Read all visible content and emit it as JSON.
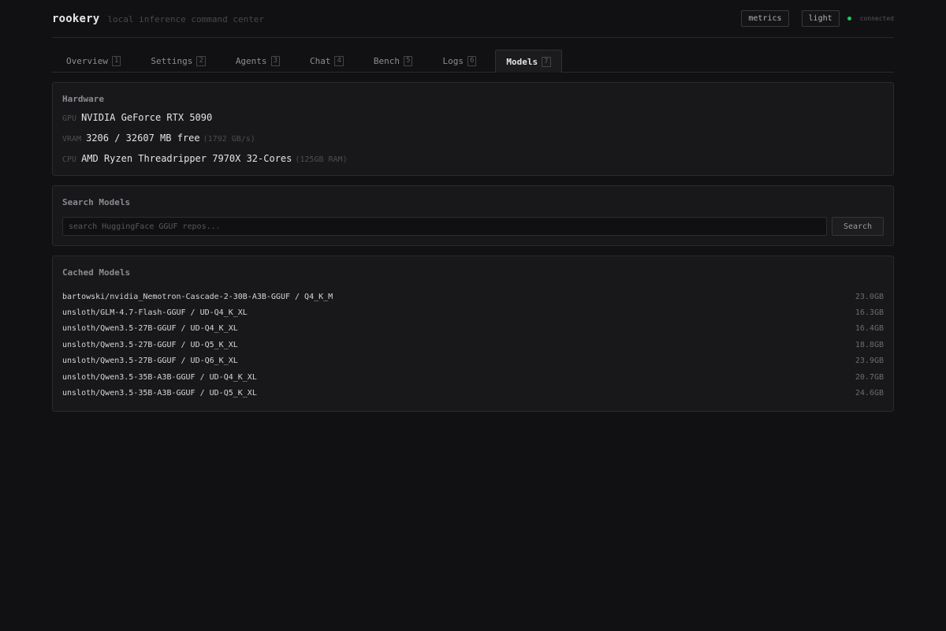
{
  "header": {
    "logo": "rookery",
    "tagline": "local inference command center",
    "metrics_label": "metrics",
    "theme_label": "light",
    "status_text": "connected",
    "status_color": "#22c55e"
  },
  "tabs": [
    {
      "label": "Overview",
      "key": "1",
      "active": false
    },
    {
      "label": "Settings",
      "key": "2",
      "active": false
    },
    {
      "label": "Agents",
      "key": "3",
      "active": false
    },
    {
      "label": "Chat",
      "key": "4",
      "active": false
    },
    {
      "label": "Bench",
      "key": "5",
      "active": false
    },
    {
      "label": "Logs",
      "key": "6",
      "active": false
    },
    {
      "label": "Models",
      "key": "7",
      "active": true
    }
  ],
  "hardware": {
    "title": "Hardware",
    "gpu_key": "GPU",
    "gpu_value": "NVIDIA GeForce RTX 5090",
    "vram_key": "VRAM",
    "vram_value": "3206 / 32607 MB free",
    "vram_note": "(1792 GB/s)",
    "cpu_key": "CPU",
    "cpu_value": "AMD Ryzen Threadripper 7970X 32-Cores",
    "cpu_note": "(125GB RAM)"
  },
  "search": {
    "title": "Search Models",
    "placeholder": "search HuggingFace GGUF repos...",
    "value": "",
    "button_label": "Search"
  },
  "cached": {
    "title": "Cached Models",
    "models": [
      {
        "name": "bartowski/nvidia_Nemotron-Cascade-2-30B-A3B-GGUF / Q4_K_M",
        "size": "23.0GB"
      },
      {
        "name": "unsloth/GLM-4.7-Flash-GGUF / UD-Q4_K_XL",
        "size": "16.3GB"
      },
      {
        "name": "unsloth/Qwen3.5-27B-GGUF / UD-Q4_K_XL",
        "size": "16.4GB"
      },
      {
        "name": "unsloth/Qwen3.5-27B-GGUF / UD-Q5_K_XL",
        "size": "18.8GB"
      },
      {
        "name": "unsloth/Qwen3.5-27B-GGUF / UD-Q6_K_XL",
        "size": "23.9GB"
      },
      {
        "name": "unsloth/Qwen3.5-35B-A3B-GGUF / UD-Q4_K_XL",
        "size": "20.7GB"
      },
      {
        "name": "unsloth/Qwen3.5-35B-A3B-GGUF / UD-Q5_K_XL",
        "size": "24.6GB"
      }
    ]
  }
}
